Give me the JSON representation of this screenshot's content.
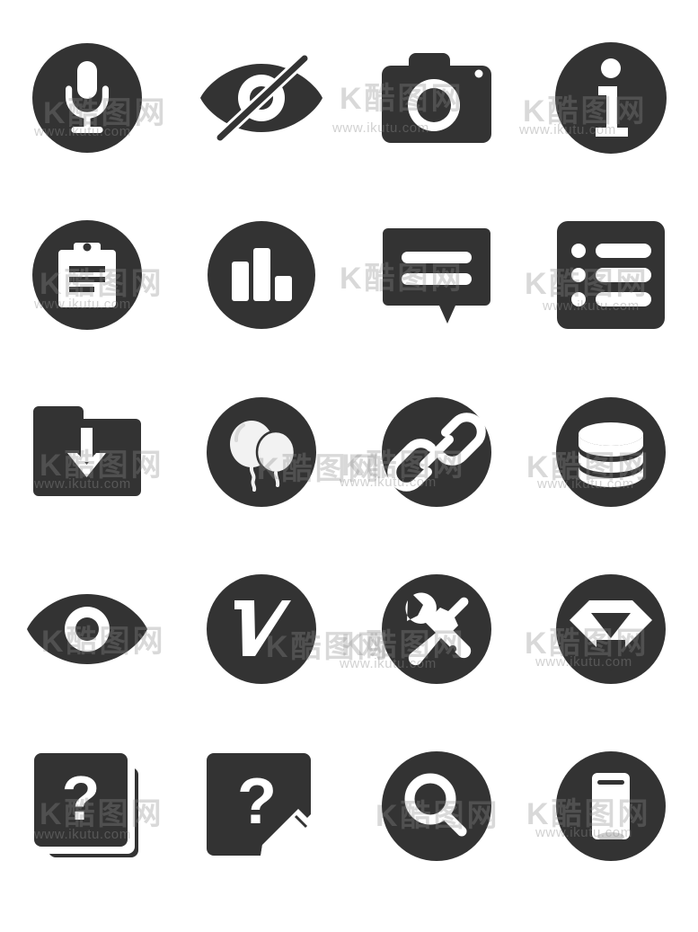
{
  "sheet": {
    "title": "Icon Set Sheet",
    "background_color": "#ffffff",
    "icon_color": "#333333",
    "columns": 4,
    "rows": 5,
    "total_icons": 20
  },
  "watermark": {
    "mark_text": "K酷图网",
    "url_text": "www.ikutu.com",
    "color": "#8d8d8d",
    "opacity": "0.3"
  },
  "icons": [
    {
      "index": 1,
      "name": "microphone",
      "label": "Microphone",
      "shape": "circle",
      "row": 1,
      "col": 1
    },
    {
      "index": 2,
      "name": "eye-off",
      "label": "Hide / Eye Off",
      "shape": "eye",
      "row": 1,
      "col": 2
    },
    {
      "index": 3,
      "name": "camera",
      "label": "Camera",
      "shape": "camera-body",
      "row": 1,
      "col": 3
    },
    {
      "index": 4,
      "name": "info",
      "label": "Information",
      "shape": "circle",
      "row": 1,
      "col": 4
    },
    {
      "index": 5,
      "name": "clipboard",
      "label": "Clipboard",
      "shape": "circle",
      "row": 2,
      "col": 1
    },
    {
      "index": 6,
      "name": "bar-chart",
      "label": "Bar Chart",
      "shape": "circle",
      "row": 2,
      "col": 2
    },
    {
      "index": 7,
      "name": "chat-bubble",
      "label": "Chat Message",
      "shape": "bubble",
      "row": 2,
      "col": 3
    },
    {
      "index": 8,
      "name": "bullet-list",
      "label": "List",
      "shape": "rounded-square",
      "row": 2,
      "col": 4
    },
    {
      "index": 9,
      "name": "folder-download",
      "label": "Folder Download",
      "shape": "folder",
      "row": 3,
      "col": 1
    },
    {
      "index": 10,
      "name": "balloons",
      "label": "Balloons",
      "shape": "circle",
      "row": 3,
      "col": 2
    },
    {
      "index": 11,
      "name": "link",
      "label": "Link",
      "shape": "circle",
      "row": 3,
      "col": 3
    },
    {
      "index": 12,
      "name": "database",
      "label": "Database",
      "shape": "circle",
      "row": 3,
      "col": 4
    },
    {
      "index": 13,
      "name": "eye",
      "label": "View / Eye",
      "shape": "eye",
      "row": 4,
      "col": 1
    },
    {
      "index": 14,
      "name": "letter-v",
      "label": "Letter V",
      "shape": "circle",
      "row": 4,
      "col": 2
    },
    {
      "index": 15,
      "name": "tools",
      "label": "Tools",
      "shape": "circle",
      "row": 4,
      "col": 3
    },
    {
      "index": 16,
      "name": "diamond",
      "label": "Diamond / Gem",
      "shape": "circle",
      "row": 4,
      "col": 4
    },
    {
      "index": 17,
      "name": "faq-stack",
      "label": "FAQ Stack",
      "shape": "square-stack",
      "row": 5,
      "col": 1
    },
    {
      "index": 18,
      "name": "question-edit",
      "label": "Question Edit",
      "shape": "square",
      "row": 5,
      "col": 2
    },
    {
      "index": 19,
      "name": "search",
      "label": "Search",
      "shape": "circle",
      "row": 5,
      "col": 3
    },
    {
      "index": 20,
      "name": "mobile-device",
      "label": "Mobile Device",
      "shape": "circle",
      "row": 5,
      "col": 4
    }
  ]
}
